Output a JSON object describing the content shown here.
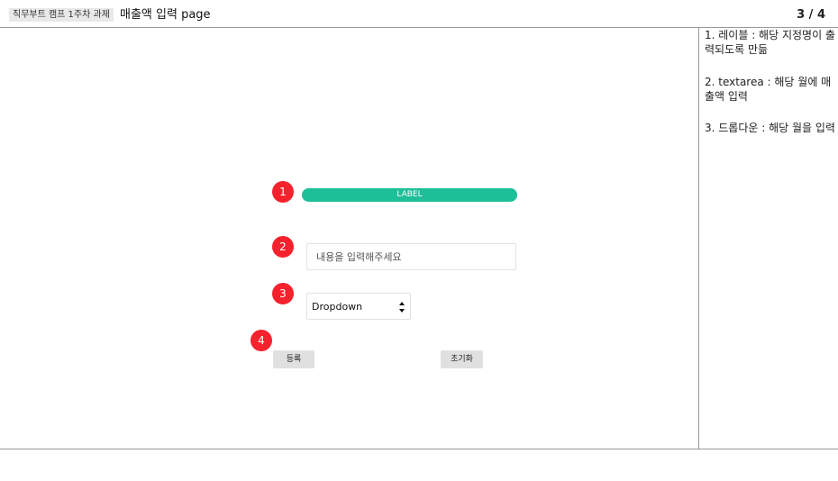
{
  "header": {
    "tag": "직무부트 캠프 1주차 과제",
    "title": "매출액 입력 page",
    "page_indicator": "3 / 4"
  },
  "notes": [
    "1. 레이블 : 해당 지정명이 출력되도록 만듦",
    "2. textarea : 해당 월에 매출액 입력",
    "3. 드롭다운 : 해당 월을 입력"
  ],
  "markers": [
    "1",
    "2",
    "3",
    "4"
  ],
  "form": {
    "label_text": "LABEL",
    "input_placeholder": "내용을 입력해주세요",
    "dropdown_value": "Dropdown",
    "register_label": "등록",
    "reset_label": "초기화"
  },
  "colors": {
    "label_bar": "#1dbf98",
    "marker": "#f5222d"
  }
}
